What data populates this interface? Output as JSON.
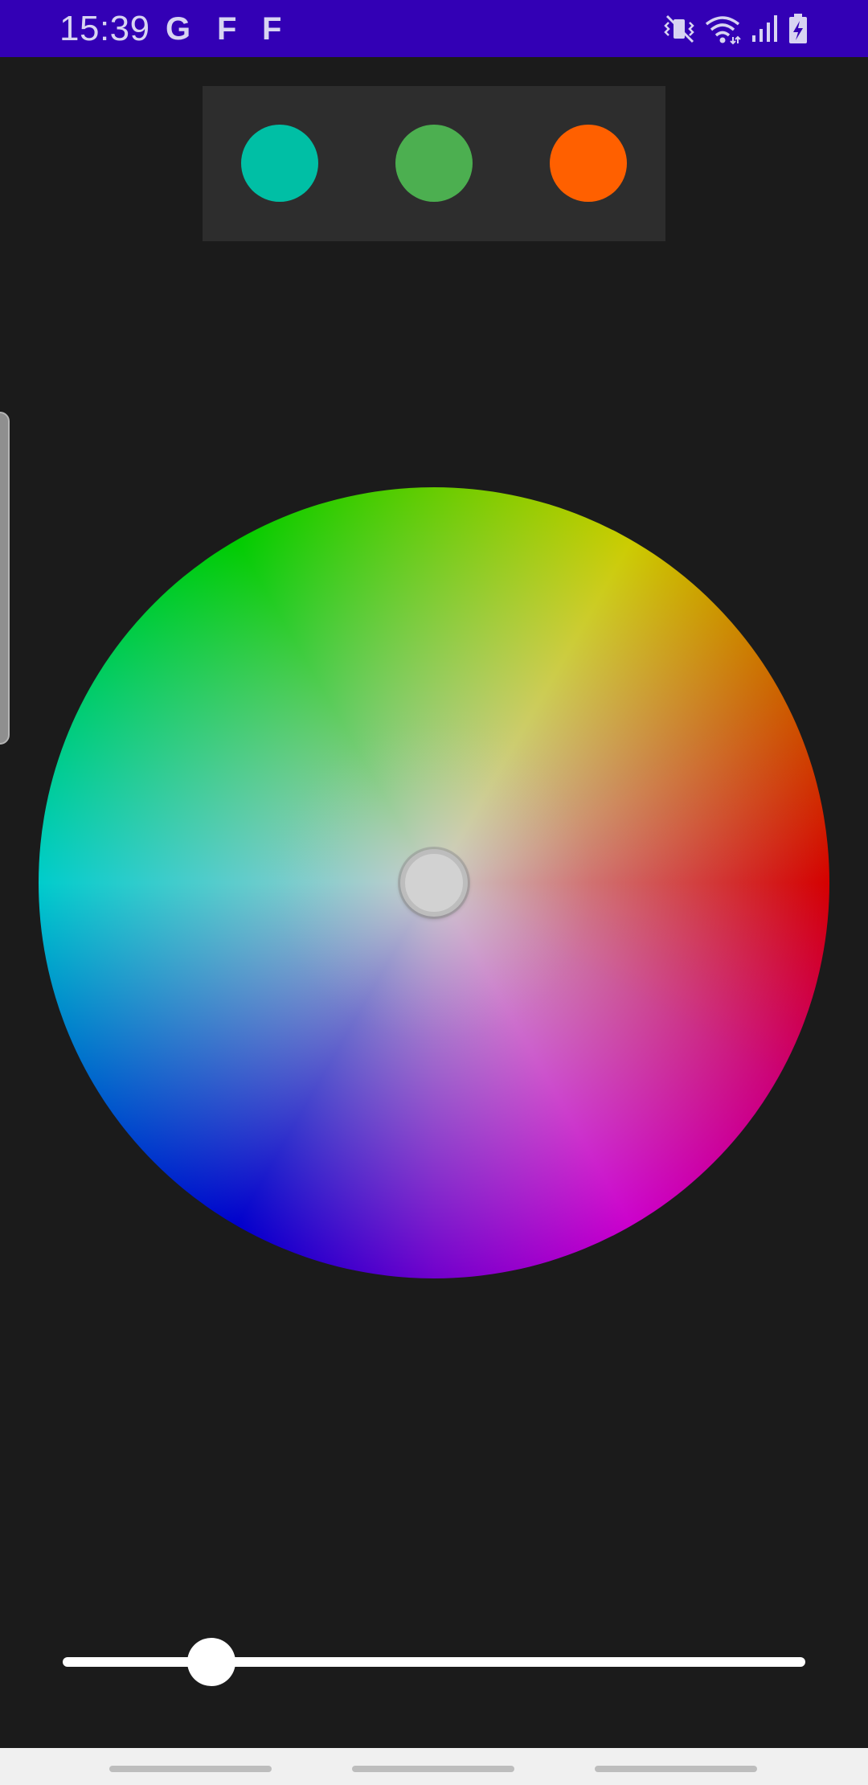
{
  "status_bar": {
    "time": "15:39",
    "notifications": [
      "G",
      "F",
      "F"
    ],
    "icons": [
      "vibrate-mute-icon",
      "wifi-icon",
      "signal-icon",
      "battery-charging-icon"
    ],
    "background": "#3300b5",
    "foreground": "#d8d4f2"
  },
  "swatches": [
    {
      "color": "#00bfa5"
    },
    {
      "color": "#4caf50"
    },
    {
      "color": "#ff6000"
    }
  ],
  "slider": {
    "value": 0.2
  },
  "colors": {
    "background": "#1b1b1b",
    "panel": "#2d2d2d"
  }
}
